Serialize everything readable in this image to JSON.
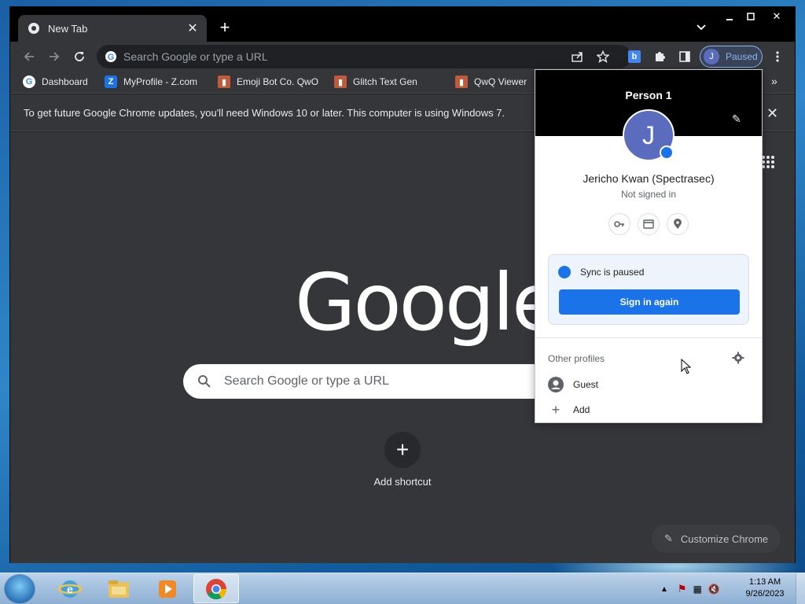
{
  "window": {
    "tab": {
      "title": "New Tab",
      "favicon": "chrome-icon"
    },
    "controls": [
      "minimize-icon",
      "maximize-icon",
      "close-icon"
    ]
  },
  "toolbar": {
    "omnibox_placeholder": "Search Google or type a URL",
    "profile_status": "Paused",
    "profile_initial": "J"
  },
  "bookmarks": [
    {
      "label": "Dashboard",
      "icon": "google-icon"
    },
    {
      "label": "MyProfile - Z.com",
      "icon": "z-icon"
    },
    {
      "label": "Emoji Bot Co. QwO",
      "icon": "app-icon"
    },
    {
      "label": "Glitch Text Gen",
      "icon": "app-icon"
    },
    {
      "label": "QwQ Viewer",
      "icon": "app-icon"
    }
  ],
  "infobar": {
    "message": "To get future Google Chrome updates, you'll need Windows 10 or later. This computer is using Windows 7."
  },
  "ntp": {
    "logo": "Google",
    "search_placeholder": "Search Google or type a URL",
    "add_shortcut": "Add shortcut",
    "customize": "Customize Chrome"
  },
  "profile_menu": {
    "header_name": "Person 1",
    "avatar_initial": "J",
    "full_name": "Jericho Kwan (Spectrasec)",
    "status": "Not signed in",
    "sync_message": "Sync is paused",
    "sign_in_button": "Sign in again",
    "other_profiles_label": "Other profiles",
    "guest": "Guest",
    "add": "Add"
  },
  "taskbar": {
    "clock_time": "1:13 AM",
    "clock_date": "9/26/2023"
  },
  "colors": {
    "accent": "#1a73e8",
    "frame": "#202124",
    "toolbar": "#35363a",
    "paused_text": "#8ab4f8"
  }
}
